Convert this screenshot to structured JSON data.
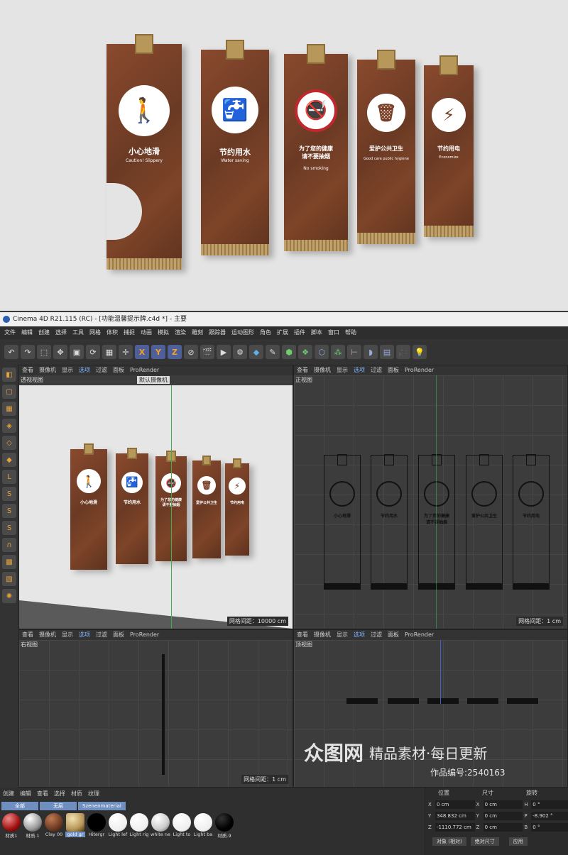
{
  "signs": [
    {
      "cn": "小心地滑",
      "en": "Caution! Slippery"
    },
    {
      "cn": "节约用水",
      "en": "Water saving"
    },
    {
      "cn": "为了您的健康\n请不要抽烟",
      "en": "No smoking"
    },
    {
      "cn": "爱护公共卫生",
      "en": "Good care public hygiene"
    },
    {
      "cn": "节约用电",
      "en": "Economize"
    }
  ],
  "window": {
    "title": "Cinema 4D R21.115 (RC) - [功能温馨提示牌.c4d *] - 主要"
  },
  "menu": [
    "文件",
    "编辑",
    "创建",
    "选择",
    "工具",
    "网格",
    "体积",
    "捕捉",
    "动画",
    "模拟",
    "渲染",
    "雕刻",
    "跟踪器",
    "运动图形",
    "角色",
    "扩展",
    "插件",
    "脚本",
    "窗口",
    "帮助"
  ],
  "viewport_menu": [
    "查看",
    "摄像机",
    "显示",
    "选项",
    "过滤",
    "面板",
    "ProRender"
  ],
  "viewports": {
    "persp": {
      "name": "透视视图",
      "camera": "默认摄像机",
      "grid": "网格间距：10000 cm"
    },
    "front": {
      "name": "正视图",
      "grid": "网格间距：1 cm"
    },
    "right": {
      "name": "右视图",
      "grid": "网格间距：1 cm"
    },
    "top": {
      "name": "顶视图"
    }
  },
  "material_menu": [
    "创建",
    "编辑",
    "查看",
    "选择",
    "材质",
    "纹理"
  ],
  "material_tabs": [
    "全部",
    "无层",
    "Szenenmaterial"
  ],
  "materials": [
    "材质1",
    "材质.1",
    "Clay 00",
    "gold gr",
    "Hitergr",
    "Light lef",
    "Light rig",
    "white ne",
    "Light to",
    "Light ba",
    "材质.9"
  ],
  "attr": {
    "headers": [
      "位置",
      "尺寸",
      "旋转"
    ],
    "rows": [
      {
        "k1": "X",
        "v1": "0 cm",
        "k2": "X",
        "v2": "0 cm",
        "k3": "H",
        "v3": "0 °"
      },
      {
        "k1": "Y",
        "v1": "348.832 cm",
        "k2": "Y",
        "v2": "0 cm",
        "k3": "P",
        "v3": "-8.902 °"
      },
      {
        "k1": "Z",
        "v1": "-1110.772 cm",
        "k2": "Z",
        "v2": "0 cm",
        "k3": "B",
        "v3": "0 °"
      }
    ],
    "mode": "对象 (相对)",
    "size_mode": "绝对尺寸",
    "apply": "应用"
  },
  "watermark": {
    "brand": "众图网",
    "slogan": "精品素材·每日更新",
    "id": "作品编号:2540163"
  }
}
